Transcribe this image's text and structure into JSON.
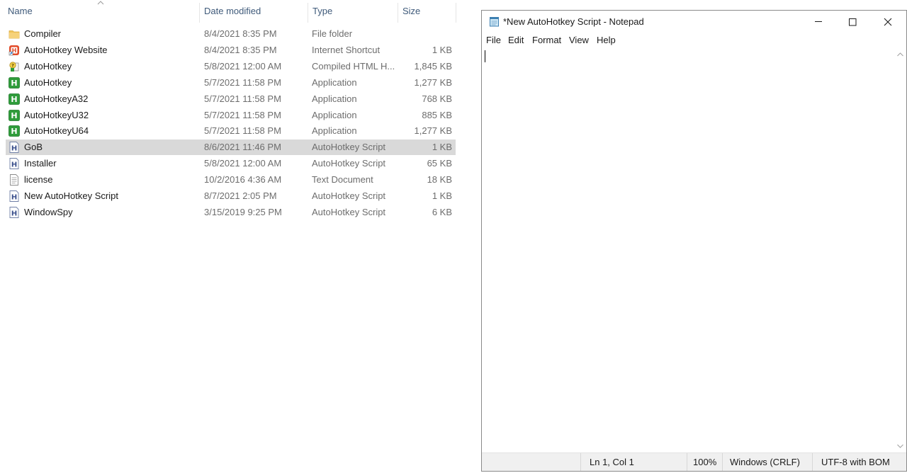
{
  "explorer": {
    "columns": {
      "name": "Name",
      "date": "Date modified",
      "type": "Type",
      "size": "Size"
    },
    "files": [
      {
        "name": "Compiler",
        "date": "8/4/2021 8:35 PM",
        "type": "File folder",
        "size": "",
        "icon": "folder-icon",
        "selected": false
      },
      {
        "name": "AutoHotkey Website",
        "date": "8/4/2021 8:35 PM",
        "type": "Internet Shortcut",
        "size": "1 KB",
        "icon": "internet-shortcut-icon",
        "selected": false
      },
      {
        "name": "AutoHotkey",
        "date": "5/8/2021 12:00 AM",
        "type": "Compiled HTML H...",
        "size": "1,845 KB",
        "icon": "chm-help-icon",
        "selected": false
      },
      {
        "name": "AutoHotkey",
        "date": "5/7/2021 11:58 PM",
        "type": "Application",
        "size": "1,277 KB",
        "icon": "autohotkey-app-icon",
        "selected": false
      },
      {
        "name": "AutoHotkeyA32",
        "date": "5/7/2021 11:58 PM",
        "type": "Application",
        "size": "768 KB",
        "icon": "autohotkey-app-icon",
        "selected": false
      },
      {
        "name": "AutoHotkeyU32",
        "date": "5/7/2021 11:58 PM",
        "type": "Application",
        "size": "885 KB",
        "icon": "autohotkey-app-icon",
        "selected": false
      },
      {
        "name": "AutoHotkeyU64",
        "date": "5/7/2021 11:58 PM",
        "type": "Application",
        "size": "1,277 KB",
        "icon": "autohotkey-app-icon",
        "selected": false
      },
      {
        "name": "GoB",
        "date": "8/6/2021 11:46 PM",
        "type": "AutoHotkey Script",
        "size": "1 KB",
        "icon": "ahk-script-icon",
        "selected": true
      },
      {
        "name": "Installer",
        "date": "5/8/2021 12:00 AM",
        "type": "AutoHotkey Script",
        "size": "65 KB",
        "icon": "ahk-script-icon",
        "selected": false
      },
      {
        "name": "license",
        "date": "10/2/2016 4:36 AM",
        "type": "Text Document",
        "size": "18 KB",
        "icon": "text-document-icon",
        "selected": false
      },
      {
        "name": "New AutoHotkey Script",
        "date": "8/7/2021 2:05 PM",
        "type": "AutoHotkey Script",
        "size": "1 KB",
        "icon": "ahk-script-icon",
        "selected": false
      },
      {
        "name": "WindowSpy",
        "date": "3/15/2019 9:25 PM",
        "type": "AutoHotkey Script",
        "size": "6 KB",
        "icon": "ahk-script-icon",
        "selected": false
      }
    ]
  },
  "notepad": {
    "title": "*New AutoHotkey Script - Notepad",
    "menu": [
      "File",
      "Edit",
      "Format",
      "View",
      "Help"
    ],
    "content": "",
    "status": {
      "position": "Ln 1, Col 1",
      "zoom": "100%",
      "line_ending": "Windows (CRLF)",
      "encoding": "UTF-8 with BOM"
    }
  },
  "colors": {
    "header_text": "#3f5a7a",
    "selected_row": "#d9d9d9",
    "ahk_green": "#2e9c3a",
    "folder_yellow": "#f2c55c"
  }
}
